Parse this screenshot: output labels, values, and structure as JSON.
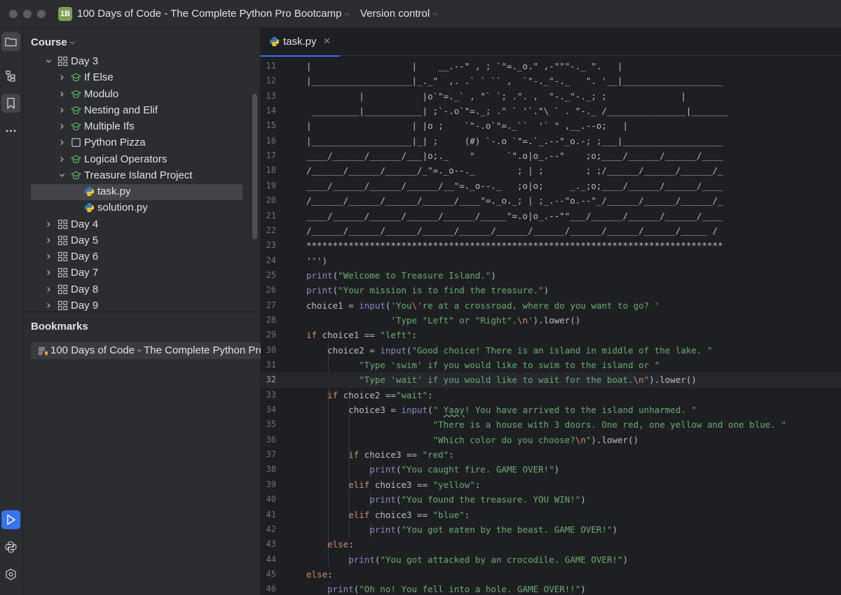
{
  "titlebar": {
    "project_badge": "1B",
    "project_name": "100 Days of Code - The Complete Python Pro Bootcamp",
    "version_control": "Version control"
  },
  "project_panel": {
    "title": "Course",
    "tree": [
      {
        "label": "Day 3",
        "level": 0,
        "icon": "module-icon",
        "expanded": true
      },
      {
        "label": "If Else",
        "level": 1,
        "icon": "graduation-cap-icon",
        "expanded": false
      },
      {
        "label": "Modulo",
        "level": 1,
        "icon": "graduation-cap-icon",
        "expanded": false
      },
      {
        "label": "Nesting and Elif",
        "level": 1,
        "icon": "graduation-cap-icon",
        "expanded": false
      },
      {
        "label": "Multiple Ifs",
        "level": 1,
        "icon": "graduation-cap-icon",
        "expanded": false
      },
      {
        "label": "Python Pizza",
        "level": 1,
        "icon": "task-square-icon",
        "expanded": false
      },
      {
        "label": "Logical Operators",
        "level": 1,
        "icon": "graduation-cap-icon",
        "expanded": false
      },
      {
        "label": "Treasure Island Project",
        "level": 1,
        "icon": "graduation-cap-icon",
        "expanded": true
      },
      {
        "label": "task.py",
        "level": 2,
        "icon": "python-file-icon",
        "selected": true
      },
      {
        "label": "solution.py",
        "level": 2,
        "icon": "python-file-icon"
      },
      {
        "label": "Day 4",
        "level": 0,
        "icon": "module-icon",
        "expanded": false
      },
      {
        "label": "Day 5",
        "level": 0,
        "icon": "module-icon",
        "expanded": false
      },
      {
        "label": "Day 6",
        "level": 0,
        "icon": "module-icon",
        "expanded": false
      },
      {
        "label": "Day 7",
        "level": 0,
        "icon": "module-icon",
        "expanded": false
      },
      {
        "label": "Day 8",
        "level": 0,
        "icon": "module-icon",
        "expanded": false
      },
      {
        "label": "Day 9",
        "level": 0,
        "icon": "module-icon",
        "expanded": false
      }
    ]
  },
  "bookmarks": {
    "title": "Bookmarks",
    "items": [
      "100 Days of Code - The Complete Python Pro"
    ]
  },
  "editor": {
    "tab_label": "task.py",
    "current_line": 32,
    "lines": [
      {
        "n": 11,
        "indent": 0,
        "tokens": [
          {
            "t": "|                   |    __.--\" , ; `\"=._o.\" ,-\"\"\"-._ \".   |"
          }
        ]
      },
      {
        "n": 12,
        "indent": 0,
        "tokens": [
          {
            "t": "|___________________|_._\"  ,. .` ` `` ,  `\"-._\"-._   \". '__|___________________"
          }
        ]
      },
      {
        "n": 13,
        "indent": 0,
        "tokens": [
          {
            "t": "          |           |o`\"=._` , \"` `; .\". ,  \"-._\"-._; ;              |"
          }
        ]
      },
      {
        "n": 14,
        "indent": 0,
        "tokens": [
          {
            "t": " _________|___________| ;`-.o`\"=._; .\" ` '`.\"\\ ` . \"-._ /_______________|_______"
          }
        ]
      },
      {
        "n": 15,
        "indent": 0,
        "tokens": [
          {
            "t": "|                   | |o ;    `\"-.o`\"=._``  '` \" ,__.--o;   |"
          }
        ]
      },
      {
        "n": 16,
        "indent": 0,
        "tokens": [
          {
            "t": "|___________________|_| ;     (#) `-.o `\"=.`_.--\"_o.-; ;___|___________________"
          }
        ]
      },
      {
        "n": 17,
        "indent": 0,
        "tokens": [
          {
            "t": "____/______/______/___|o;._    \"      `\".o|o_.--\"    ;o;____/______/______/____"
          }
        ]
      },
      {
        "n": 18,
        "indent": 0,
        "tokens": [
          {
            "t": "/______/______/______/_\"=._o--._        ; | ;        ; ;/______/______/______/_"
          }
        ]
      },
      {
        "n": 19,
        "indent": 0,
        "tokens": [
          {
            "t": "____/______/______/______/__\"=._o--._   ;o|o;     _._;o;____/______/______/____"
          }
        ]
      },
      {
        "n": 20,
        "indent": 0,
        "tokens": [
          {
            "t": "/______/______/______/______/____\"=._o._; | ;_.--\"o.--\"_/______/______/______/_"
          }
        ]
      },
      {
        "n": 21,
        "indent": 0,
        "tokens": [
          {
            "t": "____/______/______/______/______/_____\"=.o|o_.--\"\"___/______/______/______/____"
          }
        ]
      },
      {
        "n": 22,
        "indent": 0,
        "tokens": [
          {
            "t": "/______/______/______/______/______/______/______/______/______/______/_____ /"
          }
        ]
      },
      {
        "n": 23,
        "indent": 0,
        "tokens": [
          {
            "t": "*******************************************************************************"
          }
        ]
      },
      {
        "n": 24,
        "indent": 0,
        "tokens": [
          {
            "t": "''')"
          }
        ]
      },
      {
        "n": 25,
        "indent": 0,
        "tokens": [
          {
            "t": "print",
            "c": "fn"
          },
          {
            "t": "("
          },
          {
            "t": "\"Welcome to Treasure Island.\"",
            "c": "str"
          },
          {
            "t": ")"
          }
        ]
      },
      {
        "n": 26,
        "indent": 0,
        "tokens": [
          {
            "t": "print",
            "c": "fn"
          },
          {
            "t": "("
          },
          {
            "t": "\"Your mission is to find the treasure.\"",
            "c": "str"
          },
          {
            "t": ")"
          }
        ]
      },
      {
        "n": 27,
        "indent": 0,
        "tokens": [
          {
            "t": "choice1 = "
          },
          {
            "t": "input",
            "c": "fn"
          },
          {
            "t": "("
          },
          {
            "t": "'You",
            "c": "str"
          },
          {
            "t": "\\'",
            "c": "esc"
          },
          {
            "t": "re at a crossroad, where do you want to go? '",
            "c": "str"
          }
        ]
      },
      {
        "n": 28,
        "indent": 0,
        "tokens": [
          {
            "t": "                "
          },
          {
            "t": "'Type \"Left\" or \"Right\".",
            "c": "str"
          },
          {
            "t": "\\n",
            "c": "esc"
          },
          {
            "t": "'",
            "c": "str"
          },
          {
            "t": ").lower()"
          }
        ]
      },
      {
        "n": 29,
        "indent": 0,
        "tokens": [
          {
            "t": "if",
            "c": "kw"
          },
          {
            "t": " choice1 == "
          },
          {
            "t": "\"left\"",
            "c": "str"
          },
          {
            "t": ":"
          }
        ]
      },
      {
        "n": 30,
        "indent": 1,
        "tokens": [
          {
            "t": "    choice2 = "
          },
          {
            "t": "input",
            "c": "fn"
          },
          {
            "t": "("
          },
          {
            "t": "\"Good choice! There is an island in middle of the lake. \"",
            "c": "str"
          }
        ]
      },
      {
        "n": 31,
        "indent": 1,
        "tokens": [
          {
            "t": "          "
          },
          {
            "t": "\"Type 'swim' if you would like to swim to the island or \"",
            "c": "str"
          }
        ]
      },
      {
        "n": 32,
        "indent": 1,
        "tokens": [
          {
            "t": "          "
          },
          {
            "t": "\"Type 'wait' if you would like to wait for the boat.",
            "c": "str"
          },
          {
            "t": "\\n",
            "c": "esc"
          },
          {
            "t": "\"",
            "c": "str"
          },
          {
            "t": ").lower()"
          }
        ]
      },
      {
        "n": 33,
        "indent": 1,
        "tokens": [
          {
            "t": "    "
          },
          {
            "t": "if",
            "c": "kw"
          },
          {
            "t": " choice2 =="
          },
          {
            "t": "\"wait\"",
            "c": "str"
          },
          {
            "t": ":"
          }
        ]
      },
      {
        "n": 34,
        "indent": 2,
        "tokens": [
          {
            "t": "        choice3 = "
          },
          {
            "t": "input",
            "c": "fn"
          },
          {
            "t": "("
          },
          {
            "t": "\" ",
            "c": "str"
          },
          {
            "t": "Yaay",
            "c": "str squig"
          },
          {
            "t": "! You have arrived to the island unharmed. \"",
            "c": "str"
          }
        ]
      },
      {
        "n": 35,
        "indent": 2,
        "tokens": [
          {
            "t": "                        "
          },
          {
            "t": "\"There is a house with 3 doors. One red, one yellow and one blue. \"",
            "c": "str"
          }
        ]
      },
      {
        "n": 36,
        "indent": 2,
        "tokens": [
          {
            "t": "                        "
          },
          {
            "t": "\"Which color do you choose?",
            "c": "str"
          },
          {
            "t": "\\n",
            "c": "esc"
          },
          {
            "t": "\"",
            "c": "str"
          },
          {
            "t": ").lower()"
          }
        ]
      },
      {
        "n": 37,
        "indent": 2,
        "tokens": [
          {
            "t": "        "
          },
          {
            "t": "if",
            "c": "kw"
          },
          {
            "t": " choice3 == "
          },
          {
            "t": "\"red\"",
            "c": "str"
          },
          {
            "t": ":"
          }
        ]
      },
      {
        "n": 38,
        "indent": 3,
        "tokens": [
          {
            "t": "            "
          },
          {
            "t": "print",
            "c": "fn"
          },
          {
            "t": "("
          },
          {
            "t": "\"You caught fire. GAME OVER!\"",
            "c": "str"
          },
          {
            "t": ")"
          }
        ]
      },
      {
        "n": 39,
        "indent": 2,
        "tokens": [
          {
            "t": "        "
          },
          {
            "t": "elif",
            "c": "kw"
          },
          {
            "t": " choice3 == "
          },
          {
            "t": "\"yellow\"",
            "c": "str"
          },
          {
            "t": ":"
          }
        ]
      },
      {
        "n": 40,
        "indent": 3,
        "tokens": [
          {
            "t": "            "
          },
          {
            "t": "print",
            "c": "fn"
          },
          {
            "t": "("
          },
          {
            "t": "\"You found the treasure. YOU WIN!\"",
            "c": "str"
          },
          {
            "t": ")"
          }
        ]
      },
      {
        "n": 41,
        "indent": 2,
        "tokens": [
          {
            "t": "        "
          },
          {
            "t": "elif",
            "c": "kw"
          },
          {
            "t": " choice3 == "
          },
          {
            "t": "\"blue\"",
            "c": "str"
          },
          {
            "t": ":"
          }
        ]
      },
      {
        "n": 42,
        "indent": 3,
        "tokens": [
          {
            "t": "            "
          },
          {
            "t": "print",
            "c": "fn"
          },
          {
            "t": "("
          },
          {
            "t": "\"You got eaten by the beast. GAME OVER!\"",
            "c": "str"
          },
          {
            "t": ")"
          }
        ]
      },
      {
        "n": 43,
        "indent": 1,
        "tokens": [
          {
            "t": "    "
          },
          {
            "t": "else",
            "c": "kw"
          },
          {
            "t": ":"
          }
        ]
      },
      {
        "n": 44,
        "indent": 2,
        "tokens": [
          {
            "t": "        "
          },
          {
            "t": "print",
            "c": "fn"
          },
          {
            "t": "("
          },
          {
            "t": "\"You got attacked by an crocodile. GAME OVER!\"",
            "c": "str"
          },
          {
            "t": ")"
          }
        ]
      },
      {
        "n": 45,
        "indent": 0,
        "tokens": [
          {
            "t": "else",
            "c": "kw"
          },
          {
            "t": ":"
          }
        ]
      },
      {
        "n": 46,
        "indent": 1,
        "tokens": [
          {
            "t": "    "
          },
          {
            "t": "print",
            "c": "fn"
          },
          {
            "t": "("
          },
          {
            "t": "\"Oh no! You fell into a hole. GAME OVER!!\"",
            "c": "str"
          },
          {
            "t": ")"
          }
        ]
      }
    ]
  },
  "colors": {
    "accent": "#3574f0",
    "keyword": "#cf8e6d",
    "builtin": "#8888c6",
    "string": "#6aab73",
    "course_icon": "#5fb865"
  }
}
